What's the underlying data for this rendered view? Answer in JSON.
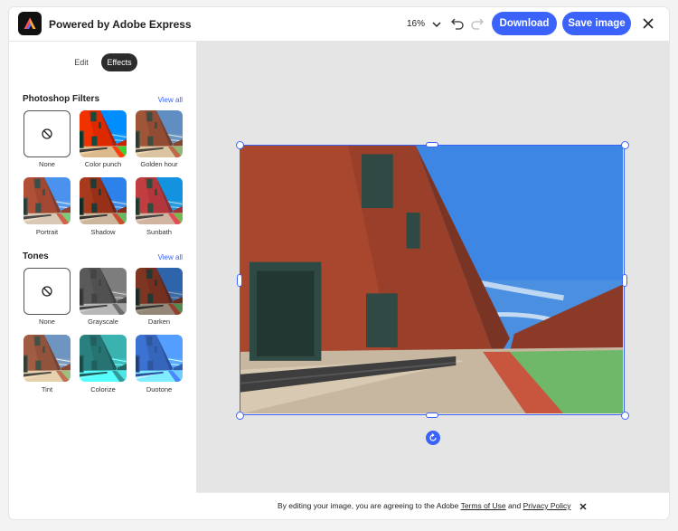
{
  "header": {
    "title": "Powered by Adobe Express",
    "zoom": "16%",
    "download_label": "Download",
    "save_label": "Save image"
  },
  "sidebar": {
    "tabs": [
      {
        "label": "Edit",
        "active": false
      },
      {
        "label": "Effects",
        "active": true
      }
    ],
    "photoshop_filters": {
      "title": "Photoshop Filters",
      "view_all": "View all",
      "items": [
        {
          "label": "None"
        },
        {
          "label": "Color punch"
        },
        {
          "label": "Golden hour"
        },
        {
          "label": "Portrait"
        },
        {
          "label": "Shadow"
        },
        {
          "label": "Sunbath"
        }
      ]
    },
    "tones": {
      "title": "Tones",
      "view_all": "View all",
      "items": [
        {
          "label": "None"
        },
        {
          "label": "Grayscale"
        },
        {
          "label": "Darken"
        },
        {
          "label": "Tint"
        },
        {
          "label": "Colorize"
        },
        {
          "label": "Duotone"
        }
      ]
    }
  },
  "footer": {
    "prefix": "By editing your image, you are agreeing to the Adobe",
    "terms_label": "Terms of Use",
    "and": "and",
    "privacy_label": "Privacy Policy"
  },
  "colors": {
    "accent": "#3b63fb",
    "canvas_bg": "#e5e5e5"
  }
}
